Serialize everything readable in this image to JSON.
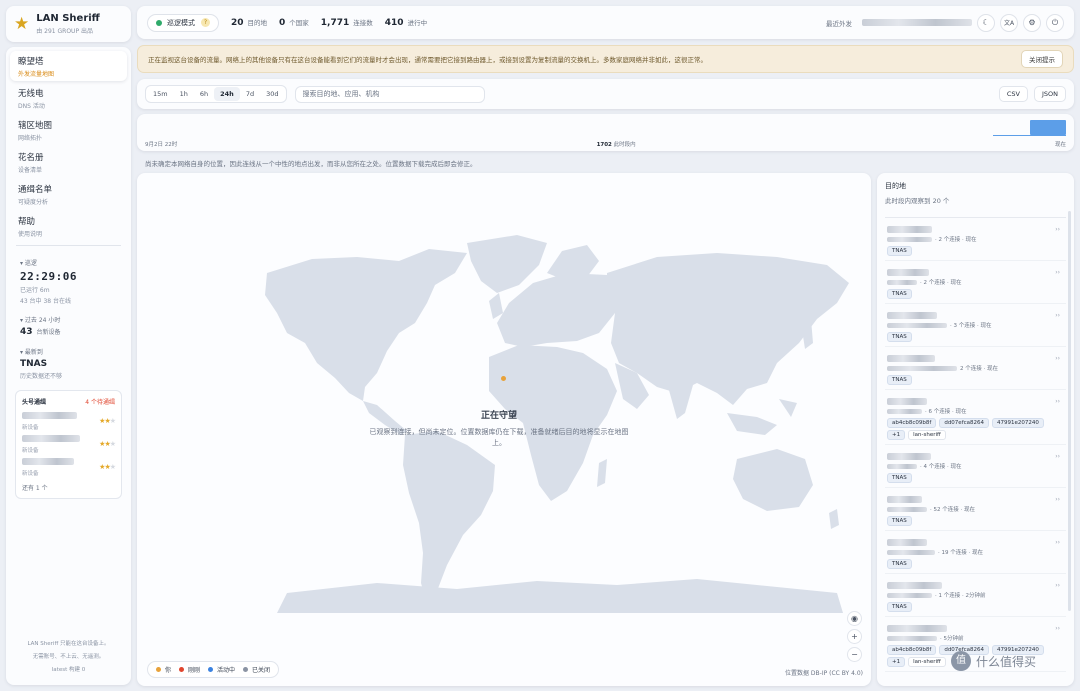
{
  "brand": {
    "name": "LAN Sheriff",
    "subtitle": "由 291 GROUP 出品"
  },
  "nav": [
    {
      "label": "瞭望塔",
      "sub": "外发流量地图",
      "active": true
    },
    {
      "label": "无线电",
      "sub": "DNS 活动"
    },
    {
      "label": "辖区地图",
      "sub": "网络拓扑"
    },
    {
      "label": "花名册",
      "sub": "设备清单"
    },
    {
      "label": "通缉名单",
      "sub": "可疑度分析"
    },
    {
      "label": "帮助",
      "sub": "使用说明"
    }
  ],
  "status": {
    "title": "巡逻",
    "clock": "22:29:06",
    "uptime": "已运行 6m",
    "online": "43 台中 38 台在线"
  },
  "past24": {
    "title": "过去 24 小时",
    "count": "43",
    "label": "台新设备"
  },
  "latest": {
    "title": "最新到",
    "device": "TNAS",
    "note": "历史数据还不够"
  },
  "top_talkers": {
    "title": "头号通缉",
    "count": "4 个待通缉",
    "items": [
      {
        "sub": "新设备",
        "rating": 2
      },
      {
        "sub": "新设备",
        "rating": 2
      },
      {
        "sub": "新设备",
        "rating": 2
      }
    ],
    "more": "还有 1 个"
  },
  "footer": {
    "line1": "LAN Sheriff 只能在这台设备上。",
    "line2": "无需账号、不上云、无遥测。",
    "line3": "latest 构建 0"
  },
  "header": {
    "mode": "巡逻模式",
    "stats": [
      {
        "value": "20",
        "label": "目的地"
      },
      {
        "value": "0",
        "label": "个国家"
      },
      {
        "value": "1,771",
        "label": "连接数"
      },
      {
        "value": "410",
        "label": "进行中"
      }
    ],
    "recent_label": "最近外发",
    "lang_icon": "文A"
  },
  "banner": {
    "text": "正在监视这台设备的流量。网络上的其他设备只有在这台设备能看到它们的流量时才会出现，通常需要把它接到路由器上，或接到设置为复制流量的交换机上。多数家庭网络并非如此，这很正常。",
    "button": "关闭提示"
  },
  "toolbar": {
    "ranges": [
      "15m",
      "1h",
      "6h",
      "24h",
      "7d",
      "30d"
    ],
    "active_range": "24h",
    "search_placeholder": "搜索目的地、应用、机构",
    "csv": "CSV",
    "json": "JSON"
  },
  "timeline": {
    "start": "9月2日 22时",
    "center_count": "1702",
    "center_label": "此时段内",
    "end": "现在"
  },
  "geo_note": "尚未确定本网络自身的位置，因此连线从一个中性的地点出发，而非从您所在之处。位置数据下载完成后即会修正。",
  "map": {
    "overlay_title": "正在守望",
    "overlay_desc": "已观察到连接，但尚未定位。位置数据库仍在下载，准备就绪后目的地将显示在地图上。",
    "legend": [
      {
        "label": "你",
        "color": "#e8a23a"
      },
      {
        "label": "刚刚",
        "color": "#e0452e"
      },
      {
        "label": "活动中",
        "color": "#3b82e0"
      },
      {
        "label": "已关闭",
        "color": "#8a93a3"
      }
    ],
    "attribution": "位置数据 DB-IP (CC BY 4.0)",
    "land_color": "#d9dfe9"
  },
  "destinations": {
    "title": "目的地",
    "subtitle": "此时段内观察到 20 个",
    "items": [
      {
        "meta": "· 2 个连接 · 现在",
        "tags": [
          "TNAS"
        ]
      },
      {
        "meta": "· 2 个连接 · 现在",
        "tags": [
          "TNAS"
        ]
      },
      {
        "meta": "· 3 个连接 · 现在",
        "tags": [
          "TNAS"
        ]
      },
      {
        "meta": "2 个连接 · 现在",
        "tags": [
          "TNAS"
        ]
      },
      {
        "meta": "· 6 个连接 · 现在",
        "tags": [
          "ab4cb8c09b8f",
          "dd07efca8264",
          "47991e207240",
          "+1"
        ],
        "extra": "lan-sheriff"
      },
      {
        "meta": "· 4 个连接 · 现在",
        "tags": [
          "TNAS"
        ]
      },
      {
        "meta": "· 52 个连接 · 现在",
        "tags": [
          "TNAS"
        ]
      },
      {
        "meta": "· 19 个连接 · 现在",
        "tags": [
          "TNAS"
        ]
      },
      {
        "meta": "· 1 个连接 · 2分钟前",
        "tags": [
          "TNAS"
        ]
      },
      {
        "meta": "· 5分钟前",
        "tags": [
          "ab4cb8c09b8f",
          "dd07efca8264",
          "47991e207240",
          "+1"
        ],
        "extra": "lan-sheriff"
      }
    ]
  },
  "watermark": {
    "text": "什么值得买",
    "glyph": "值"
  }
}
